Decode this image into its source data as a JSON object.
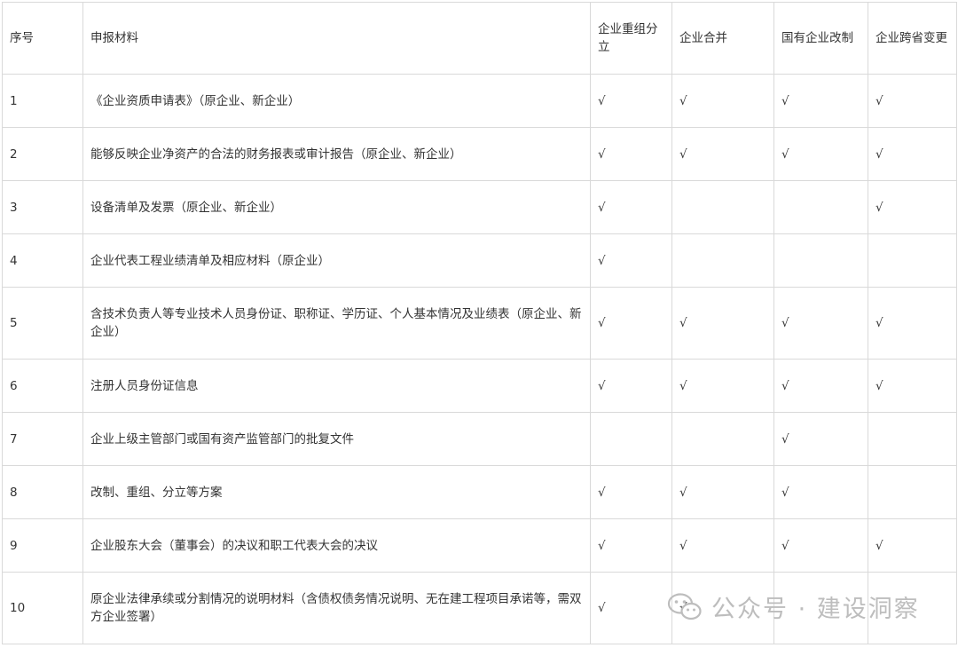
{
  "table": {
    "headers": [
      "序号",
      "申报材料",
      "企业重组分立",
      "企业合并",
      "国有企业改制",
      "企业跨省变更"
    ],
    "rows": [
      {
        "no": "1",
        "material": "《企业资质申请表》（原企业、新企业）",
        "marks": [
          "√",
          "√",
          "√",
          "√"
        ]
      },
      {
        "no": "2",
        "material": "能够反映企业净资产的合法的财务报表或审计报告（原企业、新企业）",
        "marks": [
          "√",
          "√",
          "√",
          "√"
        ]
      },
      {
        "no": "3",
        "material": "设备清单及发票（原企业、新企业）",
        "marks": [
          "√",
          "",
          "",
          "√"
        ]
      },
      {
        "no": "4",
        "material": "企业代表工程业绩清单及相应材料（原企业）",
        "marks": [
          "√",
          "",
          "",
          ""
        ]
      },
      {
        "no": "5",
        "material": "含技术负责人等专业技术人员身份证、职称证、学历证、个人基本情况及业绩表（原企业、新企业）",
        "marks": [
          "√",
          "√",
          "√",
          "√"
        ]
      },
      {
        "no": "6",
        "material": "注册人员身份证信息",
        "marks": [
          "√",
          "√",
          "√",
          "√"
        ]
      },
      {
        "no": "7",
        "material": "企业上级主管部门或国有资产监管部门的批复文件",
        "marks": [
          "",
          "",
          "√",
          ""
        ]
      },
      {
        "no": "8",
        "material": "改制、重组、分立等方案",
        "marks": [
          "√",
          "√",
          "√",
          ""
        ]
      },
      {
        "no": "9",
        "material": "企业股东大会（董事会）的决议和职工代表大会的决议",
        "marks": [
          "√",
          "√",
          "√",
          "√"
        ]
      },
      {
        "no": "10",
        "material": "原企业法律承续或分割情况的说明材料（含债权债务情况说明、无在建工程项目承诺等，需双方企业签署）",
        "marks": [
          "√",
          "√",
          "",
          ""
        ]
      }
    ]
  },
  "watermark": {
    "text": "公众号 · 建设洞察",
    "icon": "wechat-icon"
  }
}
